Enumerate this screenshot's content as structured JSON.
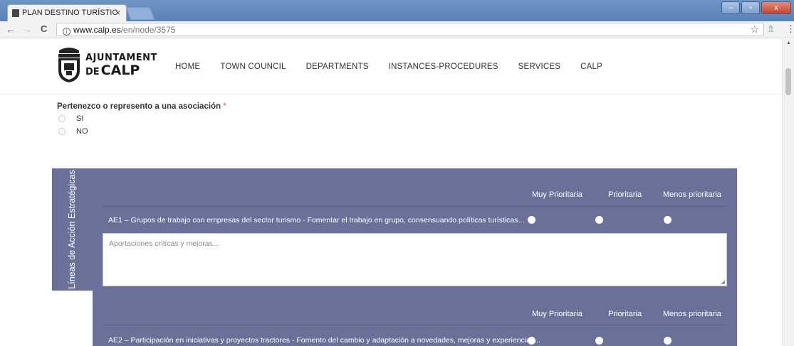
{
  "browser": {
    "tab_title": "PLAN DESTINO TURÍSTIC",
    "tab_close": "×",
    "url_domain": "www.calp.es",
    "url_path": "/en/node/3575",
    "back": "←",
    "forward": "→",
    "reload": "C",
    "star": "☆",
    "menu": "⋮",
    "extension": "⇯",
    "win_minimize": "–",
    "win_restore": "▫",
    "win_close": "x"
  },
  "site": {
    "logo_line1": "AJUNTAMENT",
    "logo_de": "DE",
    "logo_line2": "CALP",
    "nav": [
      "HOME",
      "TOWN COUNCIL",
      "DEPARTMENTS",
      "INSTANCES-PROCEDURES",
      "SERVICES",
      "CALP"
    ]
  },
  "association": {
    "label": "Pertenezco o represento a una asociación",
    "required_mark": "*",
    "options": [
      "SI",
      "NO"
    ]
  },
  "section": {
    "side_title": "Líneas de Acción Estratégicas",
    "columns": [
      "Muy Prioritaria",
      "Prioritaria",
      "Menos prioritaria"
    ],
    "q1": {
      "text": "AE1 – Grupos de trabajo con empresas del sector turismo - Fomentar el trabajo en grupo, consensuando políticas turísticas...",
      "required_mark": "*"
    },
    "textarea_placeholder": "Aportaciones críticas y mejoras...",
    "q2": {
      "text": "AE2 – Participación en iniciativas y proyectos tractores - Fomento del cambio y adaptación a novedades, mejoras y experiencias..."
    }
  }
}
